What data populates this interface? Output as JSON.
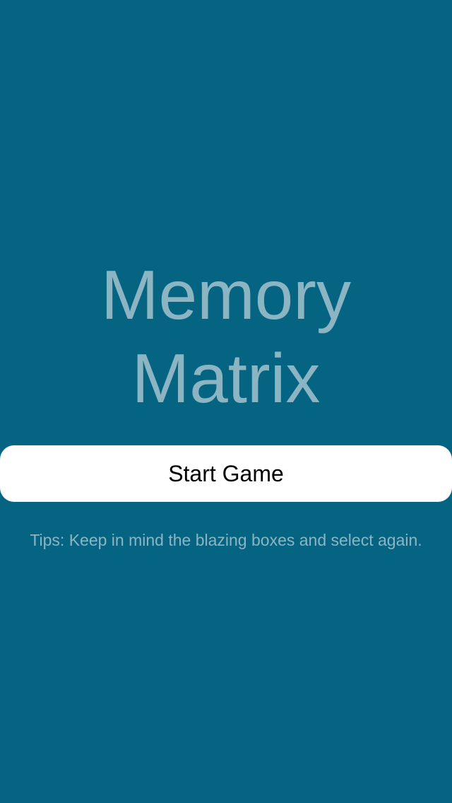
{
  "colors": {
    "background": "#056482",
    "title_text": "#8cb5c3",
    "button_background": "#ffffff",
    "button_text": "#000000",
    "tips_text": "#8cb5c3"
  },
  "title": {
    "line1": "Memory",
    "line2": "Matrix"
  },
  "start_button": {
    "label": "Start Game"
  },
  "tips": {
    "text": "Tips: Keep in mind the blazing boxes and select again."
  }
}
